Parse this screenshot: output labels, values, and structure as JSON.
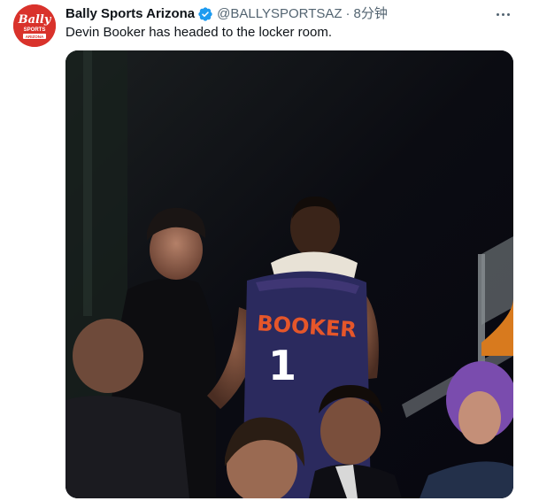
{
  "tweet": {
    "author_name": "Bally Sports Arizona",
    "handle": "@BALLYSPORTSAZ",
    "separator": "·",
    "time": "8分钟",
    "text": "Devin Booker has headed to the locker room.",
    "avatar_logo_text": "Bally SPORTS ARIZONA",
    "media": {
      "jersey_name": "BOOKER",
      "jersey_number": "1"
    }
  },
  "colors": {
    "brand": "#d9322b",
    "verified": "#1d9bf0",
    "secondary_text": "#536471",
    "primary_text": "#0f1419",
    "jersey": "#2b2a5e",
    "jersey_lettering": "#e5562a"
  },
  "icons": {
    "verified": "verified-badge-icon",
    "more": "more-horizontal-icon"
  }
}
